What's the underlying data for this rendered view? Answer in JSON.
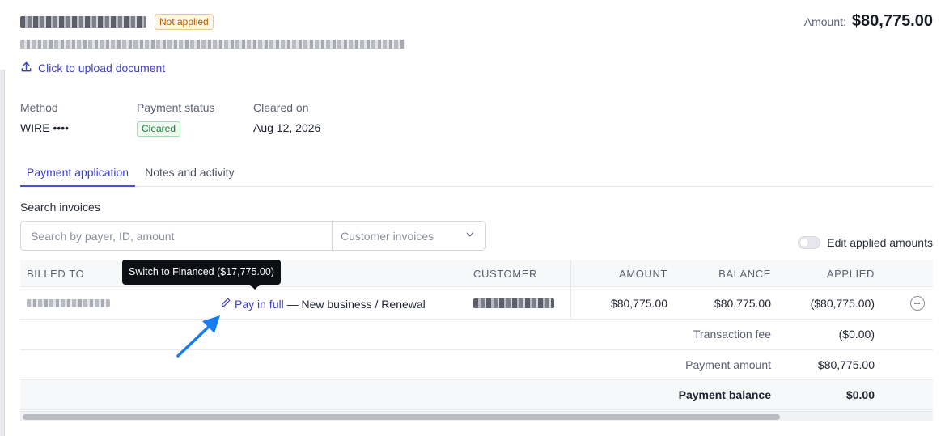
{
  "header": {
    "status_badge": "Not applied",
    "amount_label": "Amount:",
    "amount_value": "$80,775.00",
    "upload_label": "Click to upload document"
  },
  "meta": {
    "method_label": "Method",
    "method_value": "WIRE ••••",
    "status_label": "Payment status",
    "status_value": "Cleared",
    "cleared_label": "Cleared on",
    "cleared_value": "Aug 12, 2026"
  },
  "tabs": [
    {
      "label": "Payment application",
      "active": true
    },
    {
      "label": "Notes and activity",
      "active": false
    }
  ],
  "search": {
    "label": "Search invoices",
    "placeholder": "Search by payer, ID, amount",
    "filter_placeholder": "Customer invoices",
    "toggle_label": "Edit applied amounts"
  },
  "table": {
    "columns": [
      "BILLED TO",
      "CUSTOMER",
      "AMOUNT",
      "BALANCE",
      "APPLIED"
    ],
    "row": {
      "pay_label": "Pay in full",
      "deal_type": "— New business / Renewal",
      "amount": "$80,775.00",
      "balance": "$80,775.00",
      "applied": "($80,775.00)"
    },
    "summary": [
      {
        "label": "Transaction fee",
        "value": "($0.00)"
      },
      {
        "label": "Payment amount",
        "value": "$80,775.00"
      },
      {
        "label": "Payment balance",
        "value": "$0.00"
      }
    ]
  },
  "tooltip": "Switch to Financed ($17,775.00)",
  "icons": {
    "upload": "upload-icon",
    "chevron": "chevron-down-icon",
    "edit": "pencil-icon",
    "remove": "minus-circle-icon",
    "pointer": "arrow-pointer-icon"
  },
  "colors": {
    "accent": "#3b3fc2",
    "warning": "#b25c00",
    "success": "#1c7a38",
    "pointer": "#1a7cf5"
  }
}
